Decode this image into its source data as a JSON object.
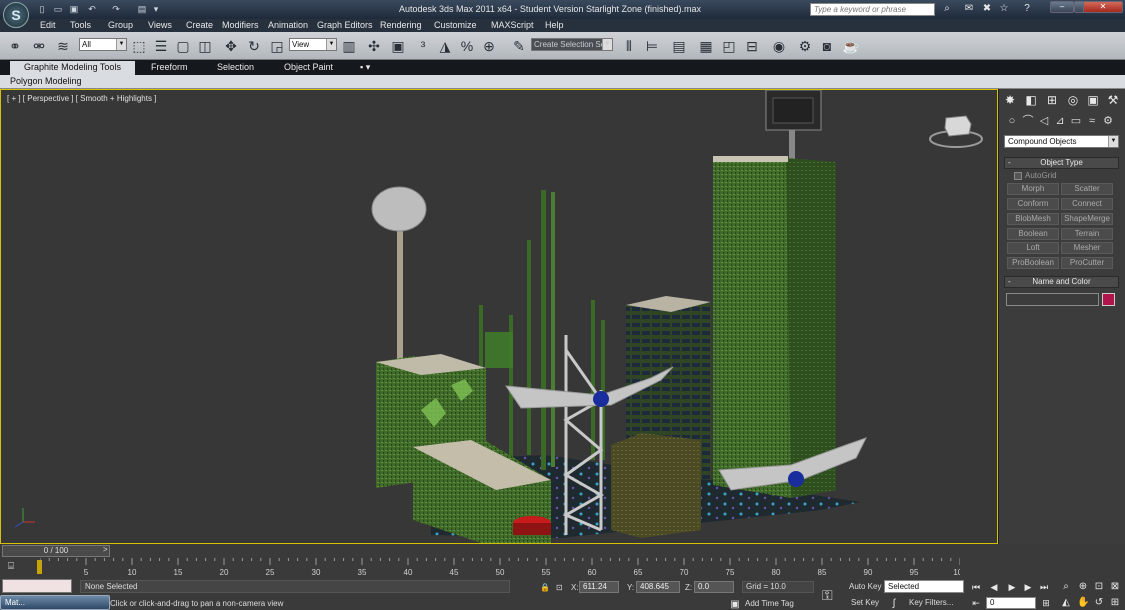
{
  "window": {
    "title": "Autodesk 3ds Max  2011 x64  - Student Version   Starlight Zone (finished).max",
    "logo_glyph": "S",
    "search_placeholder": "Type a keyword or phrase",
    "minimize_glyph": "–",
    "restore_glyph": "□",
    "close_glyph": "✕"
  },
  "menu": [
    "Edit",
    "Tools",
    "Group",
    "Views",
    "Create",
    "Modifiers",
    "Animation",
    "Graph Editors",
    "Rendering",
    "Customize",
    "MAXScript",
    "Help"
  ],
  "toolbar": {
    "selection_filter": "All",
    "ref_coord": "View",
    "named_selection_set": "Create Selection Se",
    "dropdown_glyph": "▼"
  },
  "ribbon": {
    "tabs": [
      "Graphite Modeling Tools",
      "Freeform",
      "Selection",
      "Object Paint"
    ],
    "panel_label": "Polygon Modeling",
    "extra_glyph": "▪ ▾"
  },
  "viewport": {
    "label": "[ + ] [ Perspective ] [ Smooth + Highlights ]"
  },
  "command_panel": {
    "category": "Compound Objects",
    "object_type_title": "Object Type",
    "autogrid_label": "AutoGrid",
    "buttons": [
      "Morph",
      "Scatter",
      "Conform",
      "Connect",
      "BlobMesh",
      "ShapeMerge",
      "Boolean",
      "Terrain",
      "Loft",
      "Mesher",
      "ProBoolean",
      "ProCutter"
    ],
    "name_color_title": "Name and Color",
    "object_color": "#b0144a",
    "rollout_glyph": "-"
  },
  "timeline": {
    "slider_label": "0 / 100",
    "next_glyph": ">",
    "ticks": [
      "0",
      "5",
      "10",
      "15",
      "20",
      "25",
      "30",
      "35",
      "40",
      "45",
      "50",
      "55",
      "60",
      "65",
      "70",
      "75",
      "80",
      "85",
      "90",
      "95",
      "100"
    ]
  },
  "status": {
    "selection": "None Selected",
    "prompt": "Click or click-and-drag to pan a non-camera view",
    "x_label": "X:",
    "x_value": "611.24",
    "y_label": "Y:",
    "y_value": "408.645",
    "z_label": "Z:",
    "z_value": "0.0",
    "grid": "Grid = 10.0",
    "add_time_tag": "Add Time Tag",
    "auto_key": "Auto Key",
    "set_key": "Set Key",
    "key_mode": "Selected",
    "key_filters": "Key Filters...",
    "current_frame": "0"
  },
  "taskbar": {
    "label": "Mat..."
  }
}
